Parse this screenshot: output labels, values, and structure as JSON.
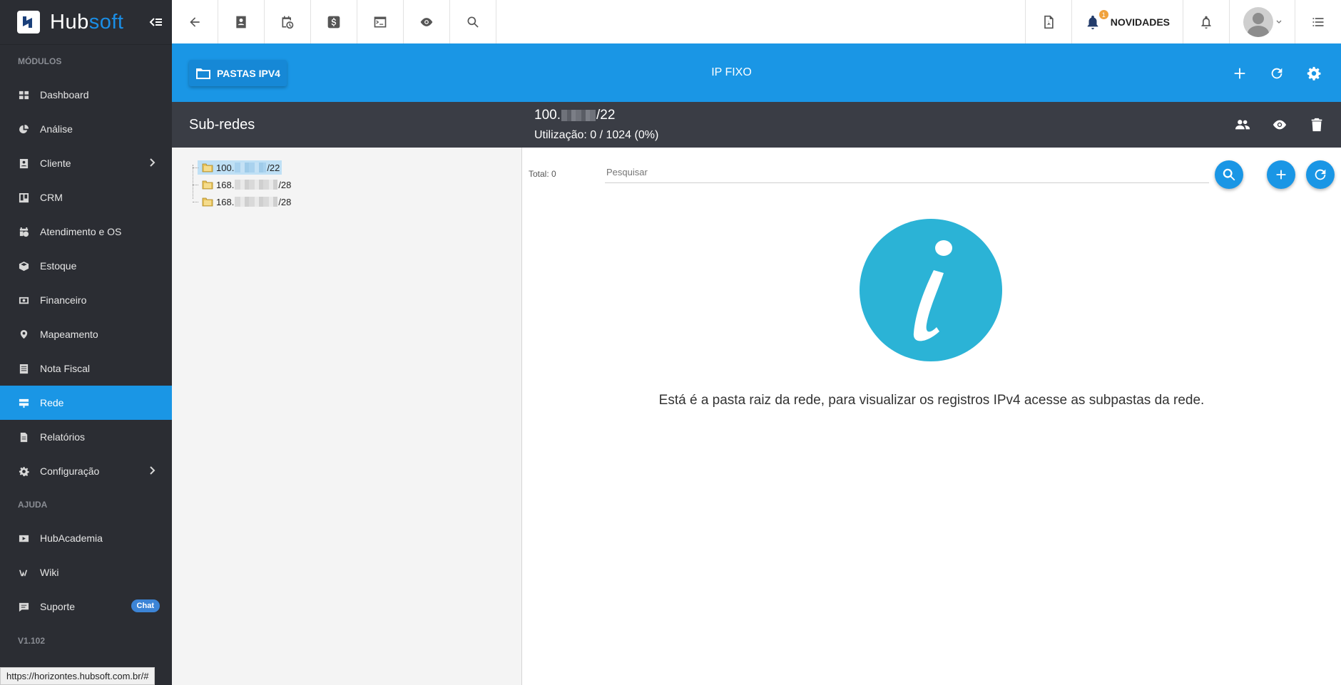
{
  "brand": {
    "name_part1": "Hub",
    "name_part2": "soft"
  },
  "sidebar": {
    "section_modules": "MÓDULOS",
    "items": [
      {
        "label": "Dashboard",
        "icon": "dashboard-icon"
      },
      {
        "label": "Análise",
        "icon": "pie-chart-icon"
      },
      {
        "label": "Cliente",
        "icon": "contact-card-icon",
        "has_submenu": true
      },
      {
        "label": "CRM",
        "icon": "kanban-icon"
      },
      {
        "label": "Atendimento e OS",
        "icon": "calendar-clock-icon"
      },
      {
        "label": "Estoque",
        "icon": "box-icon"
      },
      {
        "label": "Financeiro",
        "icon": "money-icon"
      },
      {
        "label": "Mapeamento",
        "icon": "map-pin-icon"
      },
      {
        "label": "Nota Fiscal",
        "icon": "receipt-icon"
      },
      {
        "label": "Rede",
        "icon": "network-icon",
        "active": true
      },
      {
        "label": "Relatórios",
        "icon": "document-icon"
      },
      {
        "label": "Configuração",
        "icon": "gear-icon",
        "has_submenu": true
      }
    ],
    "section_help": "AJUDA",
    "help_items": [
      {
        "label": "HubAcademia",
        "icon": "youtube-icon"
      },
      {
        "label": "Wiki",
        "icon": "wiki-icon"
      },
      {
        "label": "Suporte",
        "icon": "message-icon",
        "badge": "Chat"
      }
    ],
    "version": "V1.102"
  },
  "status_url": "https://horizontes.hubsoft.com.br/#",
  "topbar": {
    "novidades_label": "NOVIDADES",
    "novidades_count": "1"
  },
  "header": {
    "folders_button": "PASTAS IPV4",
    "title": "IP FIXO"
  },
  "tree": {
    "title": "Sub-redes",
    "nodes": [
      {
        "prefix": "100.",
        "suffix": "/22",
        "selected": true
      },
      {
        "prefix": "168.",
        "suffix": "/28",
        "selected": false
      },
      {
        "prefix": "168.",
        "suffix": "/28",
        "selected": false
      }
    ]
  },
  "detail": {
    "title_prefix": "100.",
    "title_suffix": "/22",
    "usage": "Utilização: 0 / 1024 (0%)",
    "total": "Total: 0",
    "search_placeholder": "Pesquisar",
    "info_message": "Está é a pasta raiz da rede, para visualizar os registros IPv4 acesse as subpastas da rede."
  },
  "colors": {
    "accent": "#1a96e5",
    "sidebar_bg": "#2b2d33",
    "panel_header_bg": "#3a3d45",
    "info_circle": "#2bb3d6"
  }
}
